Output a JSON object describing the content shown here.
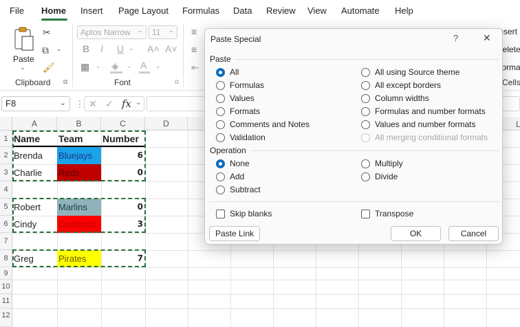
{
  "menu": {
    "items": [
      "File",
      "Home",
      "Insert",
      "Page Layout",
      "Formulas",
      "Data",
      "Review",
      "View",
      "Automate",
      "Help"
    ],
    "active": "Home"
  },
  "ribbon": {
    "clipboard": {
      "paste_label": "Paste",
      "group_label": "Clipboard"
    },
    "font": {
      "font_name": "Aptos Narrow",
      "font_size": "11",
      "group_label": "Font",
      "bold": "B",
      "italic": "I",
      "underline": "U",
      "grow": "A˄",
      "shrink": "A˅",
      "font_color": "A"
    },
    "cells": {
      "insert": "Insert",
      "delete": "Delete",
      "format": "Format",
      "group_label": "Cells"
    }
  },
  "formula_bar": {
    "name_box": "F8",
    "fx": "fx",
    "cancel": "✕",
    "enter": "✓"
  },
  "sheet": {
    "columns": [
      "A",
      "B",
      "C",
      "D"
    ],
    "rows": [
      "1",
      "2",
      "3",
      "4",
      "5",
      "6",
      "7",
      "8",
      "9",
      "10",
      "11",
      "12"
    ],
    "headers": {
      "name": "Name",
      "team": "Team",
      "number": "Number"
    },
    "records": [
      {
        "name": "Brenda",
        "team": "Bluejays",
        "number": "6",
        "color": "#1aa3e8",
        "text": "#1f3a8a"
      },
      {
        "name": "Charlie",
        "team": "Reds",
        "number": "0",
        "color": "#c00000",
        "text": "#5a0000"
      },
      {
        "name": "Robert",
        "team": "Marlins",
        "number": "0",
        "color": "#8fb3ba",
        "text": "#1f3f4a"
      },
      {
        "name": "Cindy",
        "team": "Cardinals",
        "number": "3",
        "color": "#ff0000",
        "text": "#c00000"
      },
      {
        "name": "Greg",
        "team": "Pirates",
        "number": "7",
        "color": "#ffff00",
        "text": "#6b5800"
      }
    ]
  },
  "dialog": {
    "title": "Paste Special",
    "help": "?",
    "close": "✕",
    "paste_section": "Paste",
    "paste_left": [
      "All",
      "Formulas",
      "Values",
      "Formats",
      "Comments and Notes",
      "Validation"
    ],
    "paste_right": [
      "All using Source theme",
      "All except borders",
      "Column widths",
      "Formulas and number formats",
      "Values and number formats",
      "All merging conditional formats"
    ],
    "paste_selected": "All",
    "operation_section": "Operation",
    "operation_left": [
      "None",
      "Add",
      "Subtract"
    ],
    "operation_right": [
      "Multiply",
      "Divide"
    ],
    "operation_selected": "None",
    "skip_blanks": "Skip blanks",
    "transpose": "Transpose",
    "paste_link": "Paste Link",
    "ok": "OK",
    "cancel": "Cancel",
    "accent": "#0f6cbd"
  }
}
